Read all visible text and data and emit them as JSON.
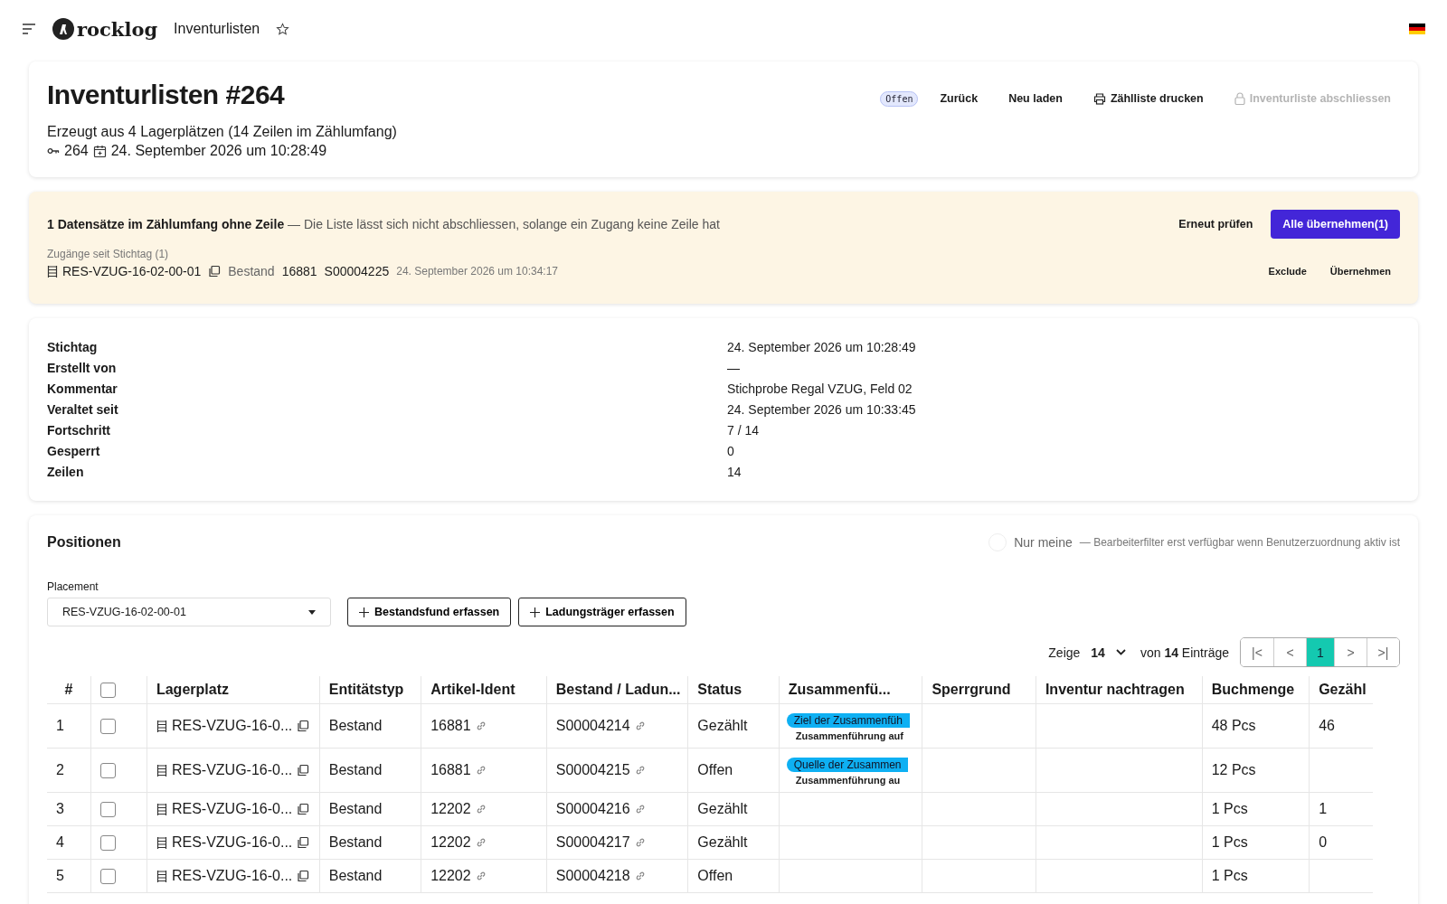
{
  "topbar": {
    "logo": "rocklog",
    "title": "Inventurlisten",
    "starred": false
  },
  "header": {
    "title": "Inventurlisten #264",
    "subtitle": "Erzeugt aus 4 Lagerplätzen (14 Zeilen im Zählumfang)",
    "id": "264",
    "created": "24. September 2026 um 10:28:49",
    "status_badge": "Offen",
    "actions": [
      {
        "label": "Zurück",
        "kind": "plain",
        "disabled": false
      },
      {
        "label": "Neu laden",
        "kind": "plain",
        "disabled": false
      },
      {
        "label": "Zählliste drucken",
        "kind": "print",
        "disabled": false
      },
      {
        "label": "Inventurliste abschliessen",
        "kind": "lock",
        "disabled": true
      }
    ]
  },
  "warning": {
    "message": "**1 Datensätze im Zählumfang ohne Zeile** — Die Liste lässt sich nicht abschliessen, solange ein Zugang keine Zeile hat",
    "recheck": "Erneut prüfen",
    "accept_all": "Alle übernehmen(1)",
    "section": "Zugänge seit Stichtag (1)",
    "entry": {
      "placement": "RES-VZUG-16-02-00-01",
      "type": "Bestand",
      "article": "16881",
      "stock": "S00004225",
      "time": "24. September 2026 um 10:34:17"
    },
    "exclude": "Exclude",
    "accept": "Übernehmen"
  },
  "details": [
    {
      "label": "Stichtag",
      "value": "24. September 2026 um 10:28:49"
    },
    {
      "label": "Erstellt von",
      "value": "—"
    },
    {
      "label": "Kommentar",
      "value": "Stichprobe Regal VZUG, Feld 02"
    },
    {
      "label": "Veraltet seit",
      "value": "24. September 2026 um 10:33:45"
    },
    {
      "label": "Fortschritt",
      "value": "7 / 14"
    },
    {
      "label": "Gesperrt",
      "value": "0"
    },
    {
      "label": "Zeilen",
      "value": "14"
    }
  ],
  "positions": {
    "title": "Positionen",
    "only_mine": {
      "label": "Nur meine",
      "on": false,
      "hint": "— Bearbeiterfilter erst verfügbar wenn Benutzerzuordnung aktiv ist"
    },
    "placement": {
      "label": "Placement",
      "value": "RES-VZUG-16-02-00-01"
    },
    "buttons": [
      "Bestandsfund erfassen",
      "Ladungsträger erfassen"
    ],
    "pager": {
      "show": "Zeige",
      "size": "14",
      "of": "von **14** Einträge",
      "pages": [
        {
          "label": "|<",
          "selected": false
        },
        {
          "label": "<",
          "selected": false
        },
        {
          "label": "1",
          "selected": true
        },
        {
          "label": ">",
          "selected": false
        },
        {
          "label": ">|",
          "selected": false
        }
      ]
    },
    "table": {
      "columns": [
        "#",
        "Lagerplatz",
        "Entitätstyp",
        "Artikel-Ident",
        "Bestand / Ladun...",
        "Status",
        "Zusammenfü...",
        "Sperrgrund",
        "Inventur nachtragen",
        "Buchmenge",
        "Gezähl"
      ],
      "all_checked": false,
      "rows": [
        {
          "num": "1",
          "checked": false,
          "placement": "RES-VZUG-16-0...",
          "type": "Bestand",
          "article": "16881",
          "stock": "S00004214",
          "status": "Gezählt",
          "merge": {
            "badge": "Ziel der Zusammenfüh",
            "note": "Zusammenführung auf"
          },
          "booked": "48 Pcs",
          "counted": "46"
        },
        {
          "num": "2",
          "checked": false,
          "placement": "RES-VZUG-16-0...",
          "type": "Bestand",
          "article": "16881",
          "stock": "S00004215",
          "status": "Offen",
          "merge": {
            "badge": "Quelle der Zusammen",
            "note": "Zusammenführung au"
          },
          "booked": "12 Pcs"
        },
        {
          "num": "3",
          "checked": false,
          "placement": "RES-VZUG-16-0...",
          "type": "Bestand",
          "article": "12202",
          "stock": "S00004216",
          "status": "Gezählt",
          "booked": "1 Pcs",
          "counted": "1"
        },
        {
          "num": "4",
          "checked": false,
          "placement": "RES-VZUG-16-0...",
          "type": "Bestand",
          "article": "12202",
          "stock": "S00004217",
          "status": "Gezählt",
          "booked": "1 Pcs",
          "counted": "0"
        },
        {
          "num": "5",
          "checked": false,
          "placement": "RES-VZUG-16-0...",
          "type": "Bestand",
          "article": "12202",
          "stock": "S00004218",
          "status": "Offen",
          "booked": "1 Pcs"
        }
      ]
    }
  }
}
